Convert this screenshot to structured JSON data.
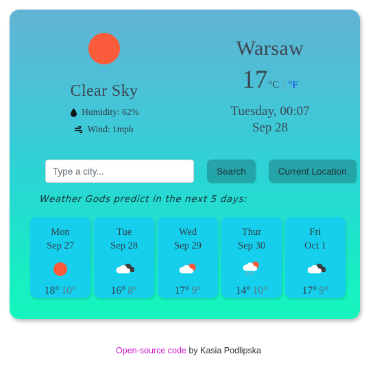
{
  "current": {
    "icon": "sun-icon",
    "condition": "Clear Sky",
    "humidity_icon": "water-droplet-icon",
    "humidity_label": "Humidity: 62%",
    "wind_icon": "wind-icon",
    "wind_label": "Wind: 1mph",
    "city": "Warsaw",
    "temperature": "17",
    "unit_celsius": "°C",
    "unit_separator": "|",
    "unit_fahrenheit": "°F",
    "unit_active": "celsius",
    "datetime_line1": "Tuesday, 00:07",
    "datetime_line2": "Sep 28"
  },
  "search": {
    "placeholder": "Type a city...",
    "value": "",
    "search_label": "Search",
    "current_location_label": "Current Location"
  },
  "forecast": {
    "heading": "Weather Gods predict in the next 5 days:",
    "days": [
      {
        "name": "Mon",
        "date": "Sep 27",
        "icon": "sun-icon",
        "high": "18°",
        "low": "10°"
      },
      {
        "name": "Tue",
        "date": "Sep 28",
        "icon": "broken-clouds-icon",
        "high": "16°",
        "low": "8°"
      },
      {
        "name": "Wed",
        "date": "Sep 29",
        "icon": "sun-behind-cloud-icon",
        "high": "17°",
        "low": "9°"
      },
      {
        "name": "Thur",
        "date": "Sep 30",
        "icon": "sun-cloud-rain-icon",
        "high": "14°",
        "low": "10°"
      },
      {
        "name": "Fri",
        "date": "Oct 1",
        "icon": "broken-clouds-icon",
        "high": "17°",
        "low": "9°"
      }
    ]
  },
  "footer": {
    "link_label": "Open-source code",
    "suffix": " by Kasia Podlipska"
  },
  "colors": {
    "gradient_top": "#62b3d4",
    "gradient_bottom": "#15f5bd",
    "card_bg": "#15cfed",
    "sun": "#f95b3b",
    "fahrenheit_link": "#1a42ee",
    "footer_link": "#c816c8"
  }
}
